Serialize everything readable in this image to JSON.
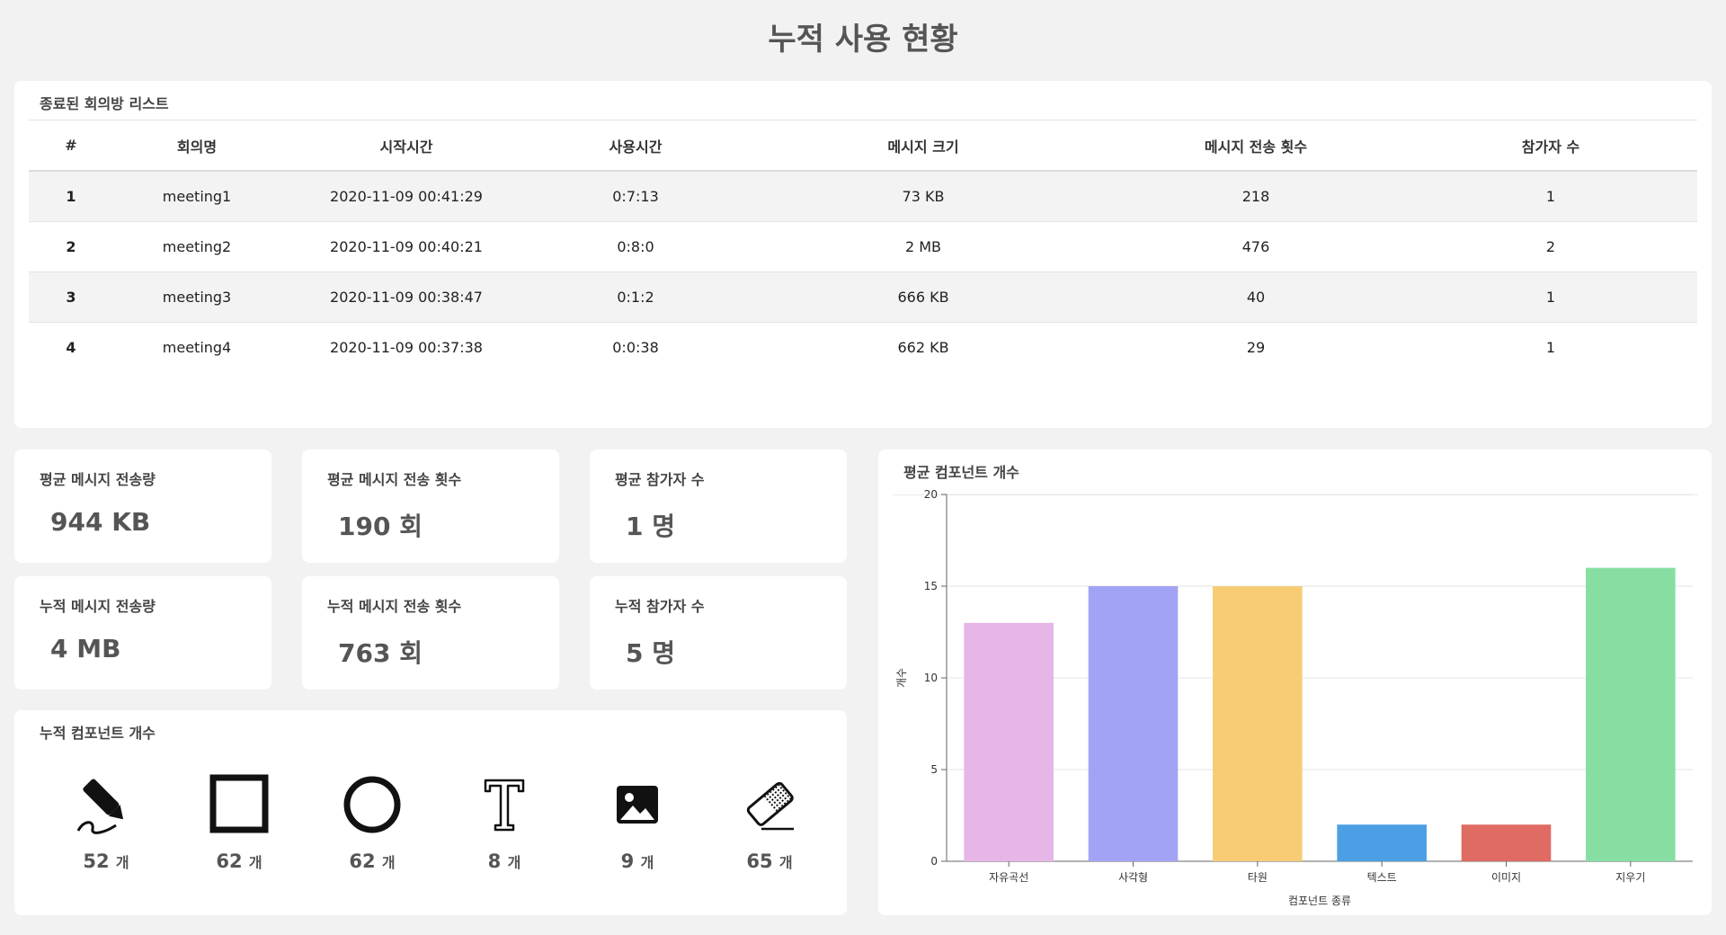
{
  "page": {
    "title": "누적 사용 현황"
  },
  "ended_rooms": {
    "title": "종료된 회의방 리스트",
    "columns": [
      "#",
      "회의명",
      "시작시간",
      "사용시간",
      "메시지 크기",
      "메시지 전송 횟수",
      "참가자 수"
    ],
    "rows": [
      [
        "1",
        "meeting1",
        "2020-11-09 00:41:29",
        "0:7:13",
        "73 KB",
        "218",
        "1"
      ],
      [
        "2",
        "meeting2",
        "2020-11-09 00:40:21",
        "0:8:0",
        "2 MB",
        "476",
        "2"
      ],
      [
        "3",
        "meeting3",
        "2020-11-09 00:38:47",
        "0:1:2",
        "666 KB",
        "40",
        "1"
      ],
      [
        "4",
        "meeting4",
        "2020-11-09 00:37:38",
        "0:0:38",
        "662 KB",
        "29",
        "1"
      ]
    ]
  },
  "stats": {
    "avg_size": {
      "label": "평균 메시지 전송량",
      "value": "944 KB"
    },
    "avg_count": {
      "label": "평균 메시지 전송 횟수",
      "value": "190 회"
    },
    "avg_users": {
      "label": "평균 참가자 수",
      "value": "1 명"
    },
    "tot_size": {
      "label": "누적 메시지 전송량",
      "value": "4 MB"
    },
    "tot_count": {
      "label": "누적 메시지 전송 횟수",
      "value": "763 회"
    },
    "tot_users": {
      "label": "누적 참가자 수",
      "value": "5 명"
    }
  },
  "components": {
    "title": "누적 컴포넌트 개수",
    "unit": "개",
    "items": [
      {
        "icon": "pen-icon",
        "count": "52"
      },
      {
        "icon": "square-icon",
        "count": "62"
      },
      {
        "icon": "circle-icon",
        "count": "62"
      },
      {
        "icon": "text-icon",
        "count": "8"
      },
      {
        "icon": "image-icon",
        "count": "9"
      },
      {
        "icon": "eraser-icon",
        "count": "65"
      }
    ]
  },
  "chart_data": {
    "type": "bar",
    "title": "평균 컴포넌트 개수",
    "categories": [
      "자유곡선",
      "사각형",
      "타원",
      "텍스트",
      "이미지",
      "지우기"
    ],
    "values": [
      13,
      15,
      15,
      2,
      2,
      16
    ],
    "colors": [
      "#e6b6e6",
      "#a3a3f5",
      "#f7cc75",
      "#4c9fe4",
      "#e06b63",
      "#86deA3"
    ],
    "xlabel": "컴포넌트 종류",
    "ylabel": "개수",
    "ylim": [
      0,
      20
    ],
    "yticks": [
      0,
      5,
      10,
      15,
      20
    ],
    "grid": true
  }
}
